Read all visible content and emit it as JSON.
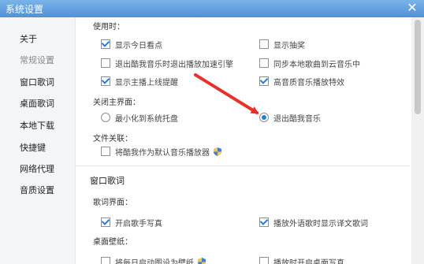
{
  "window": {
    "title": "系统设置",
    "close_icon": "close-icon"
  },
  "sidebar": {
    "items": [
      {
        "label": "关于",
        "active": false
      },
      {
        "label": "常规设置",
        "active": true
      },
      {
        "label": "窗口歌词",
        "active": false
      },
      {
        "label": "桌面歌词",
        "active": false
      },
      {
        "label": "本地下载",
        "active": false
      },
      {
        "label": "快捷键",
        "active": false
      },
      {
        "label": "网络代理",
        "active": false
      },
      {
        "label": "音质设置",
        "active": false
      }
    ]
  },
  "general": {
    "startup_label": "使用时：",
    "options": {
      "show_daily": {
        "label": "显示今日看点",
        "checked": true
      },
      "show_lottery": {
        "label": "显示抽奖",
        "checked": false
      },
      "exit_accel": {
        "label": "退出酷我音乐时退出播放加速引擎",
        "checked": false
      },
      "sync_cloud": {
        "label": "同步本地歌曲到云音乐中",
        "checked": false
      },
      "live_remind": {
        "label": "显示主播上线提醒",
        "checked": true
      },
      "hq_effect": {
        "label": "高音质音乐播放特效",
        "checked": true
      }
    },
    "close_label": "关闭主界面：",
    "close_minimize": {
      "label": "最小化到系统托盘",
      "selected": false
    },
    "close_exit": {
      "label": "退出酷我音乐",
      "selected": true
    },
    "file_assoc_label": "文件关联：",
    "default_player": {
      "label": "将酷我作为默认音乐播放器",
      "checked": false
    }
  },
  "lyrics": {
    "section_title": "窗口歌词",
    "interface_label": "歌词界面：",
    "singer_photo": {
      "label": "开启歌手写真",
      "checked": true
    },
    "translation": {
      "label": "播放外语歌时显示译文歌词",
      "checked": true
    },
    "wallpaper_label": "桌面壁纸：",
    "partial_left": {
      "label": "将每日启动图设为壁纸",
      "checked": false
    },
    "partial_right": {
      "label": "播放时开启桌面写真",
      "checked": false
    }
  },
  "annotation": {
    "arrow_color": "#e8302a"
  }
}
